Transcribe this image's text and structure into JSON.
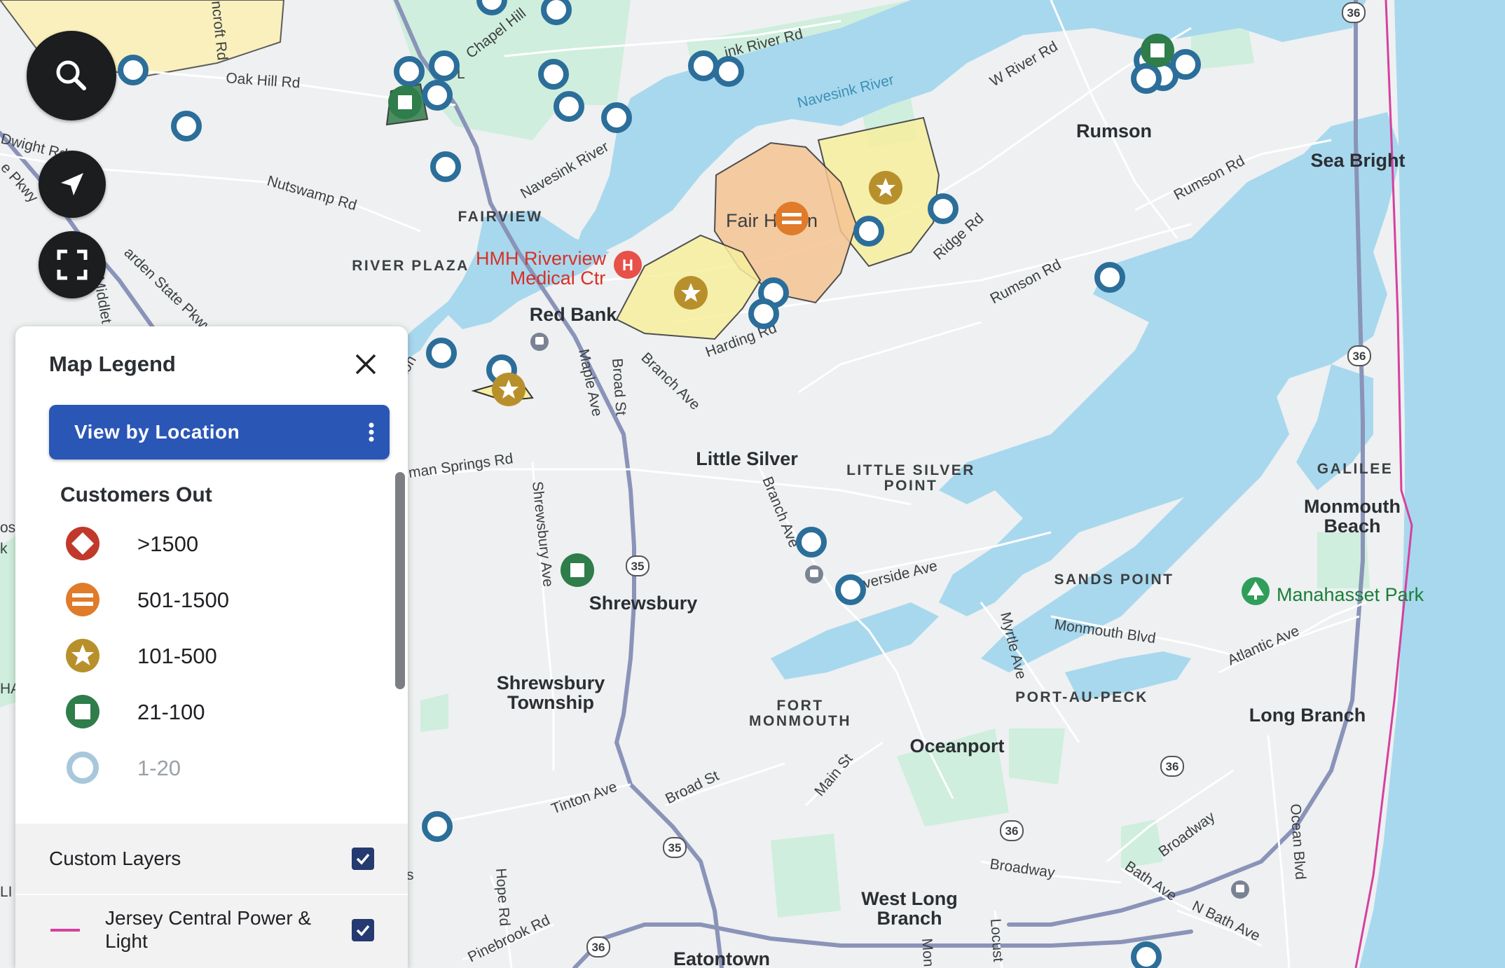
{
  "map": {
    "towns": [
      "Rumson",
      "Sea Bright",
      "Red Bank",
      "Little Silver",
      "Shrewsbury",
      "Shrewsbury",
      "Township",
      "Oceanport",
      "Long Branch",
      "West Long",
      "Branch",
      "Monmouth",
      "Beach",
      "Eatontown",
      "Fair H",
      "n"
    ],
    "neighborhoods": [
      "FAIRVIEW",
      "RIVER PLAZA",
      "LITTLE SILVER",
      "POINT",
      "SANDS POINT",
      "FORT",
      "MONMOUTH",
      "PORT-AU-PECK",
      "GALILEE"
    ],
    "roads": [
      "Oak Hill Rd",
      "Dwight Rd",
      "Nutswamp Rd",
      "Chapel Hill",
      "Navesink River",
      "ink River Rd",
      "W River Rd",
      "Rumson Rd",
      "Rumson Rd",
      "Ridge Rd",
      "Harding Rd",
      "Branch Ave",
      "Maple Ave",
      "Broad St",
      "Shrewsbury Ave",
      "man Springs Rd",
      "Branch Ave",
      "verside Ave",
      "Monmouth Blvd",
      "Myrtle Ave",
      "Atlantic Ave",
      "Tinton Ave",
      "Broad St",
      "Main St",
      "Hope Rd",
      "Pinebrook Rd",
      "Broadway",
      "Broadway",
      "Bath Ave",
      "N Bath Ave",
      "Ocean Blvd",
      "Locust",
      "Mon",
      "ncroft Rd",
      "e Pkwy",
      "arden State Pkwy",
      "Middlet",
      "L",
      "ton",
      "s",
      "LI",
      "HA",
      "os",
      "k"
    ],
    "water": [
      "Navesink River"
    ],
    "hospital": [
      "HMH Riverview",
      "Medical Ctr"
    ],
    "park": "Manahasset Park",
    "shields": [
      "36",
      "36",
      "35",
      "35",
      "36",
      "36",
      "36"
    ],
    "colors": {
      "water": "#a8d8ee",
      "land": "#eef0f1",
      "park": "#cfeedd",
      "tier_gt1500": "#c0392b",
      "tier_501_1500": "#e07b2a",
      "tier_101_500": "#b8902b",
      "tier_21_100": "#2e7d4a",
      "tier_1_20": "#2b6e9a",
      "utility_boundary": "#d6409f"
    }
  },
  "controls": {
    "search": "search-icon",
    "locate": "navigation-arrow-icon",
    "fullscreen": "fullscreen-icon"
  },
  "legend": {
    "title": "Map Legend",
    "view_button": "View by Location",
    "customers_out_title": "Customers Out",
    "tiers": [
      {
        "label": ">1500",
        "icon": "diamond-icon"
      },
      {
        "label": "501-1500",
        "icon": "equals-icon"
      },
      {
        "label": "101-500",
        "icon": "star-icon"
      },
      {
        "label": "21-100",
        "icon": "square-icon"
      },
      {
        "label": "1-20",
        "icon": "ring-icon"
      }
    ],
    "custom_layers_label": "Custom Layers",
    "custom_layers_checked": true,
    "layer_name": "Jersey Central Power & Light",
    "layer_checked": true
  }
}
